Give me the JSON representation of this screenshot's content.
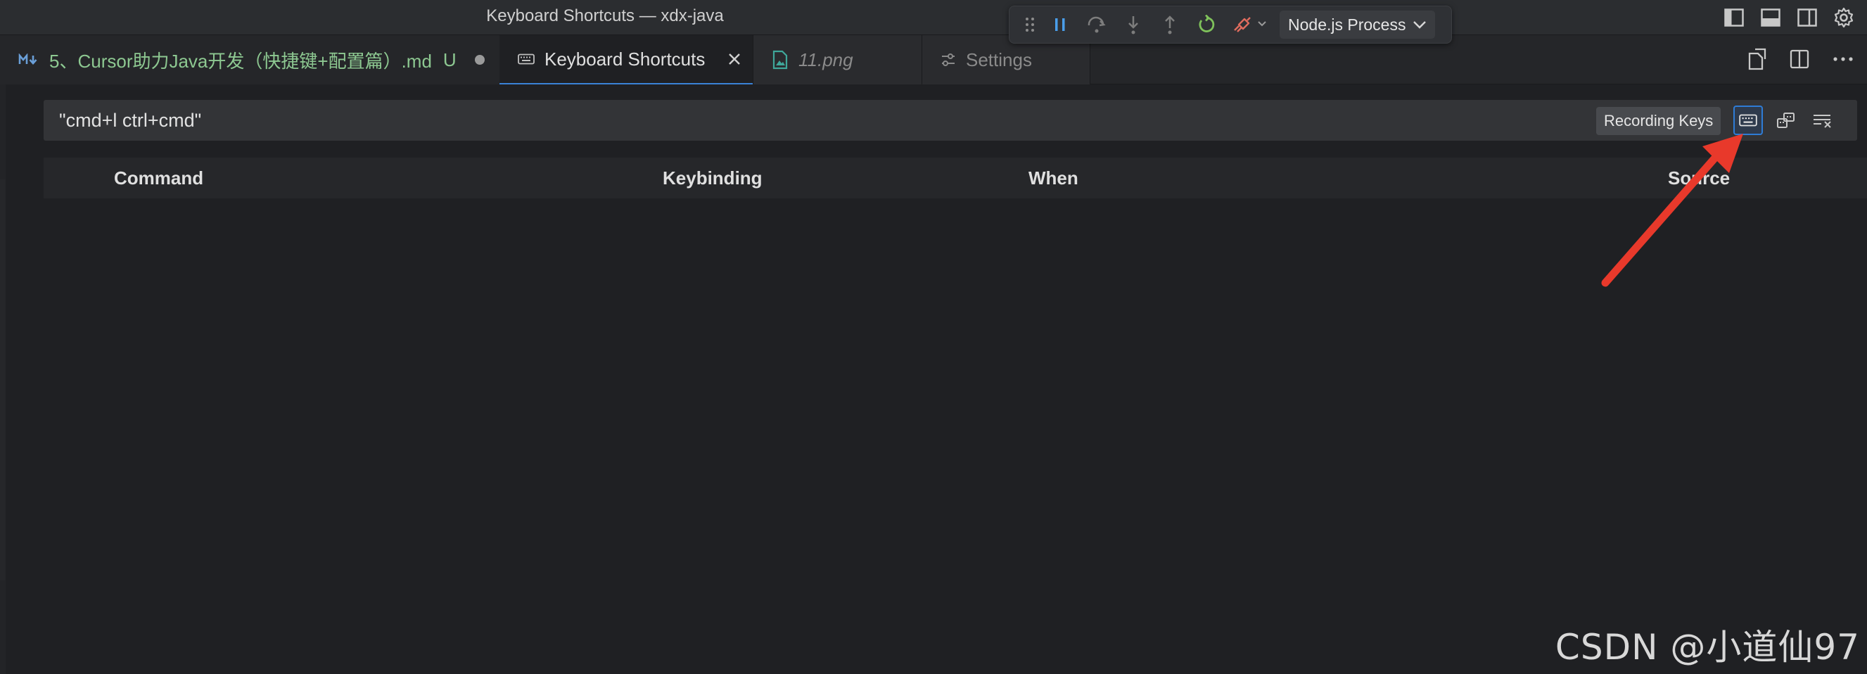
{
  "window": {
    "title": "Keyboard Shortcuts — xdx-java"
  },
  "debug_toolbar": {
    "buttons": [
      "drag-handle",
      "pause",
      "step-over",
      "step-into",
      "step-out",
      "restart",
      "disconnect"
    ],
    "process_select": "Node.js Process"
  },
  "tabs": [
    {
      "label": "5、Cursor助力Java开发（快捷键+配置篇）.md",
      "badge": "U",
      "icon": "markdown-icon"
    },
    {
      "label": "Keyboard Shortcuts",
      "icon": "keyboard-icon"
    },
    {
      "label": "11.png",
      "icon": "image-file-icon"
    },
    {
      "label": "Settings",
      "icon": "settings-sliders-icon"
    }
  ],
  "search": {
    "value": "\"cmd+l ctrl+cmd\"",
    "recording_label": "Recording Keys"
  },
  "table": {
    "columns": [
      "Command",
      "Keybinding",
      "When",
      "Source"
    ]
  },
  "watermark": "CSDN @小道仙97",
  "colors": {
    "background": "#1f2023",
    "tab_active_border": "#3a82d6",
    "modified_text": "#8dc891",
    "annotation_arrow": "#e8392b"
  }
}
